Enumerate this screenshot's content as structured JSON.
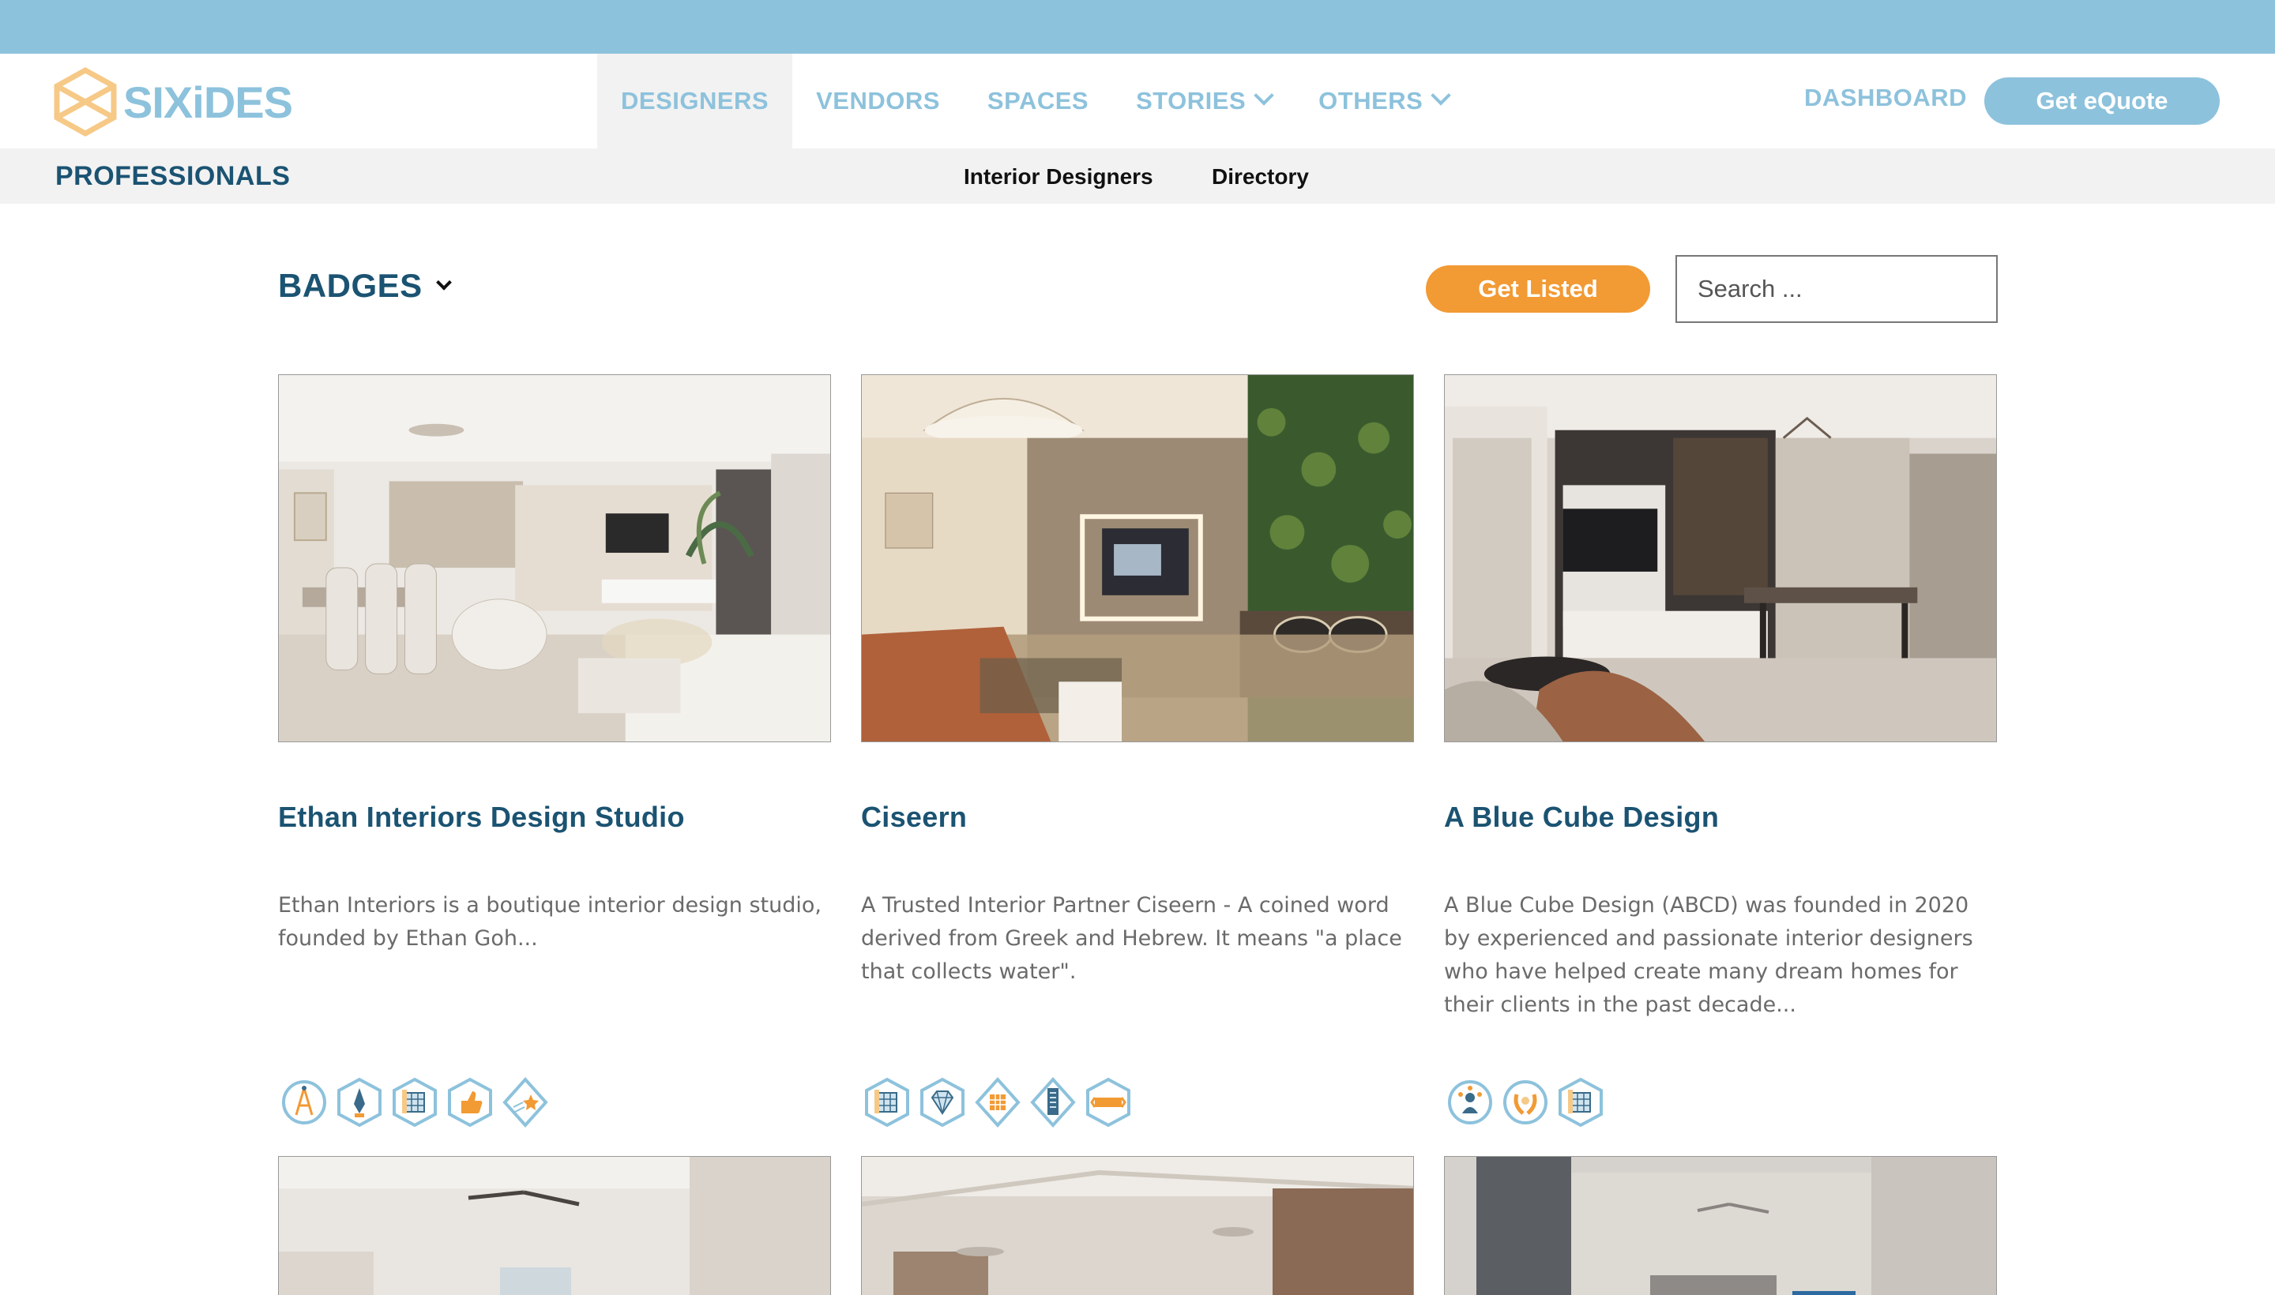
{
  "brand": {
    "name": "SIXiDES",
    "accent": "#8dc2dc",
    "dark": "#1b5372",
    "orange": "#f29a34"
  },
  "nav": {
    "items": [
      {
        "label": "DESIGNERS",
        "active": true,
        "dropdown": false
      },
      {
        "label": "VENDORS",
        "active": false,
        "dropdown": false
      },
      {
        "label": "SPACES",
        "active": false,
        "dropdown": false
      },
      {
        "label": "STORIES",
        "active": false,
        "dropdown": true
      },
      {
        "label": "OTHERS",
        "active": false,
        "dropdown": true
      }
    ],
    "dashboard": "DASHBOARD",
    "equote": "Get eQuote"
  },
  "subnav": {
    "title": "PROFESSIONALS",
    "links": [
      "Interior Designers",
      "Directory"
    ]
  },
  "toolbar": {
    "badges_label": "BADGES",
    "get_listed": "Get Listed",
    "search_placeholder": "Search ..."
  },
  "cards": [
    {
      "title": "Ethan Interiors Design Studio",
      "description": "Ethan Interiors is a boutique interior design studio, founded by Ethan Goh...",
      "badges": [
        "architect-badge-icon",
        "pen-badge-icon",
        "building-plan-badge-icon",
        "thumbs-up-badge-icon",
        "shooting-star-badge-icon"
      ]
    },
    {
      "title": "Ciseern",
      "description": "A Trusted Interior Partner Ciseern - A coined word derived from Greek and Hebrew. It means \"a place that collects water\".",
      "badges": [
        "building-plan-badge-icon",
        "diamond-badge-icon",
        "grid-badge-icon",
        "skyscraper-badge-icon",
        "ribbon-badge-icon"
      ]
    },
    {
      "title": "A Blue Cube Design",
      "description": "A Blue Cube Design (ABCD) was founded in 2020 by experienced and passionate interior designers who have helped create many dream homes for their clients in the past decade...",
      "badges": [
        "team-badge-icon",
        "laurel-badge-icon",
        "building-plan-badge-icon"
      ]
    }
  ]
}
